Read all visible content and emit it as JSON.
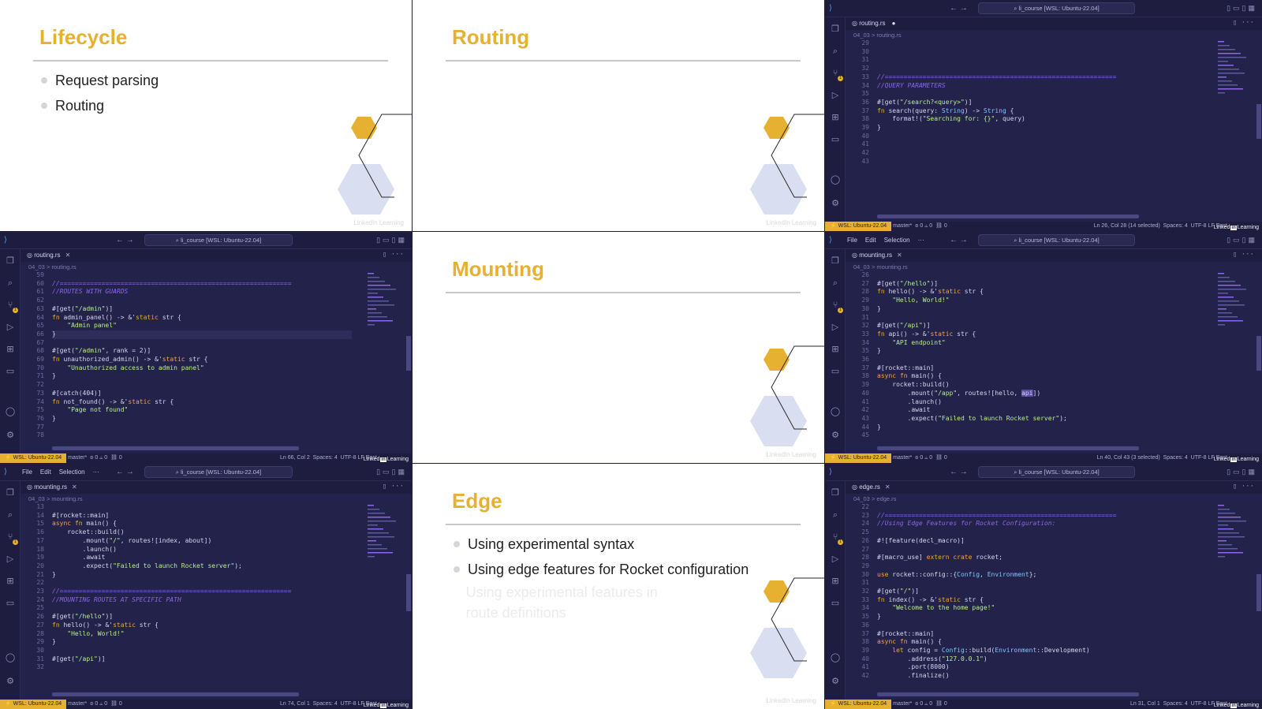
{
  "slides": {
    "lifecycle": {
      "title": "Lifecycle",
      "bullets": [
        "Request parsing",
        "Routing"
      ]
    },
    "routing": {
      "title": "Routing"
    },
    "mounting": {
      "title": "Mounting"
    },
    "edge": {
      "title": "Edge",
      "bullets": [
        "Using experimental syntax",
        "Using edge features for Rocket configuration",
        "Using experimental features in route definitions"
      ]
    },
    "watermark": "LinkedIn Learning"
  },
  "editor": {
    "menu": [
      "File",
      "Edit",
      "Selection",
      "···"
    ],
    "search": "li_course [WSL: Ubuntu-22.04]",
    "wsl": "WSL: Ubuntu-22.04",
    "branch": "master*",
    "problems": "⊗ 0 ⚠ 0",
    "ports": "⛓ 0",
    "spaces": "Spaces: 4",
    "encoding": "UTF-8",
    "eol": "LF",
    "language": "Rust",
    "linkedin": {
      "pre": "Linked",
      "box": "in",
      "post": "Learning"
    }
  },
  "editors": {
    "tr": {
      "tab": "routing.rs",
      "crumb": "04_03 > routing.rs",
      "cursor": "Ln 26, Col 28 (14 selected)"
    },
    "ml": {
      "tab": "routing.rs",
      "crumb": "04_03 > routing.rs",
      "cursor": "Ln 66, Col 2"
    },
    "mr": {
      "tab": "mounting.rs",
      "crumb": "04_03 > mounting.rs",
      "cursor": "Ln 40, Col 43 (3 selected)"
    },
    "bl": {
      "tab": "mounting.rs",
      "crumb": "04_03 > mounting.rs",
      "cursor": "Ln 74, Col 1"
    },
    "br": {
      "tab": "edge.rs",
      "crumb": "04_03 > edge.rs",
      "cursor": "Ln 31, Col 1"
    }
  },
  "code": {
    "tr": {
      "lines": [
        29,
        30,
        31,
        32,
        33,
        34,
        35,
        36,
        37,
        38,
        39,
        40,
        41,
        42,
        43
      ],
      "text": [
        "",
        "",
        "",
        "",
        "//=============================================================",
        "//QUERY PARAMETERS",
        "",
        "#[get(\"/search?<query>\")]",
        "fn search(query: String) -> String {",
        "    format!(\"Searching for: {}\", query)",
        "}",
        "",
        "",
        "",
        ""
      ]
    },
    "ml": {
      "lines": [
        59,
        60,
        61,
        62,
        63,
        64,
        65,
        66,
        67,
        68,
        69,
        70,
        71,
        72,
        73,
        74,
        75,
        76,
        77,
        78
      ],
      "text": [
        "",
        "//=============================================================",
        "//ROUTES WITH GUARDS",
        "",
        "#[get(\"/admin\")]",
        "fn admin_panel() -> &'static str {",
        "    \"Admin panel\"",
        "}",
        "",
        "#[get(\"/admin\", rank = 2)]",
        "fn unauthorized_admin() -> &'static str {",
        "    \"Unauthorized access to admin panel\"",
        "}",
        "",
        "#[catch(404)]",
        "fn not_found() -> &'static str {",
        "    \"Page not found\"",
        "}",
        "",
        ""
      ]
    },
    "mr": {
      "lines": [
        26,
        27,
        28,
        29,
        30,
        31,
        32,
        33,
        34,
        35,
        36,
        37,
        38,
        39,
        40,
        41,
        42,
        43,
        44,
        45
      ],
      "text": [
        "",
        "#[get(\"/hello\")]",
        "fn hello() -> &'static str {",
        "    \"Hello, World!\"",
        "}",
        "",
        "#[get(\"/api\")]",
        "fn api() -> &'static str {",
        "    \"API endpoint\"",
        "}",
        "",
        "#[rocket::main]",
        "async fn main() {",
        "    rocket::build()",
        "        .mount(\"/app\", routes![hello, api])",
        "        .launch()",
        "        .await",
        "        .expect(\"Failed to launch Rocket server\");",
        "}",
        ""
      ]
    },
    "bl": {
      "lines": [
        13,
        14,
        15,
        16,
        17,
        18,
        19,
        20,
        21,
        22,
        23,
        24,
        25,
        26,
        27,
        28,
        29,
        30,
        31,
        32
      ],
      "text": [
        "",
        "#[rocket::main]",
        "async fn main() {",
        "    rocket::build()",
        "        .mount(\"/\", routes![index, about])",
        "        .launch()",
        "        .await",
        "        .expect(\"Failed to launch Rocket server\");",
        "}",
        "",
        "//=============================================================",
        "//MOUNTING ROUTES AT SPECIFIC PATH",
        "",
        "#[get(\"/hello\")]",
        "fn hello() -> &'static str {",
        "    \"Hello, World!\"",
        "}",
        "",
        "#[get(\"/api\")]",
        ""
      ]
    },
    "br": {
      "lines": [
        22,
        23,
        24,
        25,
        26,
        27,
        28,
        29,
        30,
        31,
        32,
        33,
        34,
        35,
        36,
        37,
        38,
        39,
        40,
        41,
        42
      ],
      "text": [
        "",
        "//=============================================================",
        "//Using Edge Features for Rocket Configuration:",
        "",
        "#![feature(decl_macro)]",
        "",
        "#[macro_use] extern crate rocket;",
        "",
        "use rocket::config::{Config, Environment};",
        "",
        "#[get(\"/\")]",
        "fn index() -> &'static str {",
        "    \"Welcome to the home page!\"",
        "}",
        "",
        "#[rocket::main]",
        "async fn main() {",
        "    let config = Config::build(Environment::Development)",
        "        .address(\"127.0.0.1\")",
        "        .port(8000)",
        "        .finalize()"
      ]
    }
  }
}
